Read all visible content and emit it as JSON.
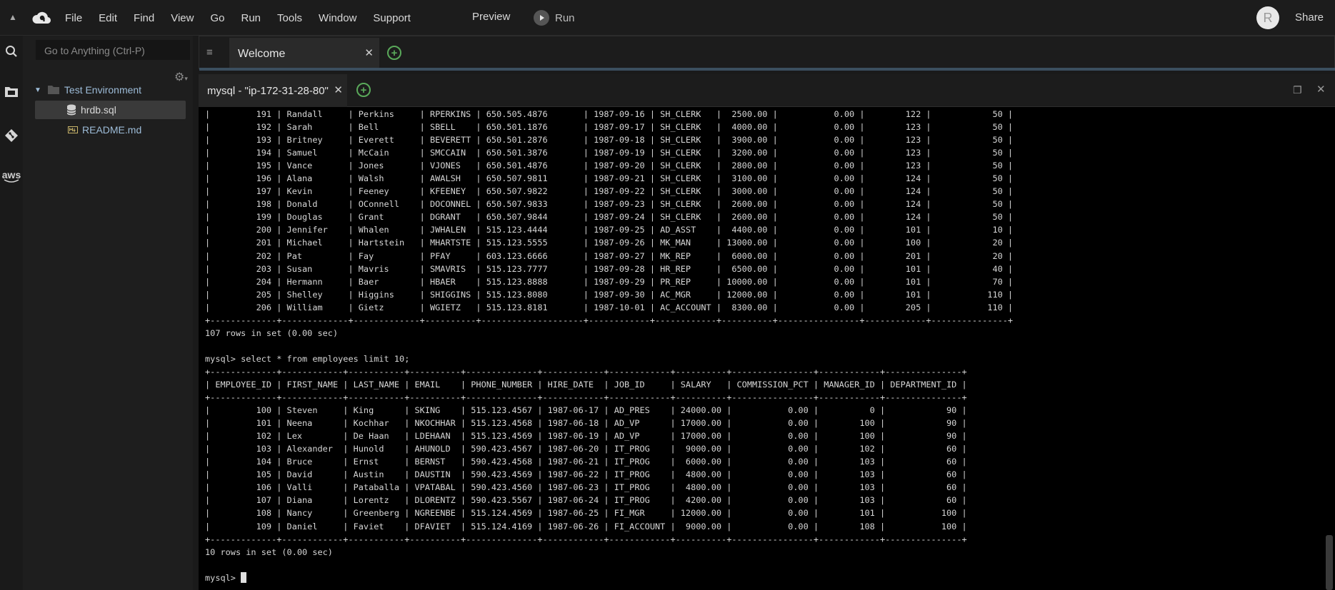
{
  "menubar": {
    "items": [
      "File",
      "Edit",
      "Find",
      "View",
      "Go",
      "Run",
      "Tools",
      "Window",
      "Support"
    ],
    "preview": "Preview",
    "run": "Run",
    "avatar_letter": "R",
    "share": "Share"
  },
  "tree": {
    "goto_placeholder": "Go to Anything (Ctrl-P)",
    "root": "Test Environment",
    "files": [
      "hrdb.sql",
      "README.md"
    ]
  },
  "tabs": {
    "welcome": "Welcome",
    "terminal_tab": "mysql - \"ip-172-31-28-80\""
  },
  "rail": {
    "aws": "aws"
  },
  "terminal": {
    "lines": [
      "|         191 | Randall     | Perkins     | RPERKINS | 650.505.4876       | 1987-09-16 | SH_CLERK   |  2500.00 |           0.00 |        122 |            50 |",
      "|         192 | Sarah       | Bell        | SBELL    | 650.501.1876       | 1987-09-17 | SH_CLERK   |  4000.00 |           0.00 |        123 |            50 |",
      "|         193 | Britney     | Everett     | BEVERETT | 650.501.2876       | 1987-09-18 | SH_CLERK   |  3900.00 |           0.00 |        123 |            50 |",
      "|         194 | Samuel      | McCain      | SMCCAIN  | 650.501.3876       | 1987-09-19 | SH_CLERK   |  3200.00 |           0.00 |        123 |            50 |",
      "|         195 | Vance       | Jones       | VJONES   | 650.501.4876       | 1987-09-20 | SH_CLERK   |  2800.00 |           0.00 |        123 |            50 |",
      "|         196 | Alana       | Walsh       | AWALSH   | 650.507.9811       | 1987-09-21 | SH_CLERK   |  3100.00 |           0.00 |        124 |            50 |",
      "|         197 | Kevin       | Feeney      | KFEENEY  | 650.507.9822       | 1987-09-22 | SH_CLERK   |  3000.00 |           0.00 |        124 |            50 |",
      "|         198 | Donald      | OConnell    | DOCONNEL | 650.507.9833       | 1987-09-23 | SH_CLERK   |  2600.00 |           0.00 |        124 |            50 |",
      "|         199 | Douglas     | Grant       | DGRANT   | 650.507.9844       | 1987-09-24 | SH_CLERK   |  2600.00 |           0.00 |        124 |            50 |",
      "|         200 | Jennifer    | Whalen      | JWHALEN  | 515.123.4444       | 1987-09-25 | AD_ASST    |  4400.00 |           0.00 |        101 |            10 |",
      "|         201 | Michael     | Hartstein   | MHARTSTE | 515.123.5555       | 1987-09-26 | MK_MAN     | 13000.00 |           0.00 |        100 |            20 |",
      "|         202 | Pat         | Fay         | PFAY     | 603.123.6666       | 1987-09-27 | MK_REP     |  6000.00 |           0.00 |        201 |            20 |",
      "|         203 | Susan       | Mavris      | SMAVRIS  | 515.123.7777       | 1987-09-28 | HR_REP     |  6500.00 |           0.00 |        101 |            40 |",
      "|         204 | Hermann     | Baer        | HBAER    | 515.123.8888       | 1987-09-29 | PR_REP     | 10000.00 |           0.00 |        101 |            70 |",
      "|         205 | Shelley     | Higgins     | SHIGGINS | 515.123.8080       | 1987-09-30 | AC_MGR     | 12000.00 |           0.00 |        101 |           110 |",
      "|         206 | William     | Gietz       | WGIETZ   | 515.123.8181       | 1987-10-01 | AC_ACCOUNT |  8300.00 |           0.00 |        205 |           110 |",
      "+-------------+-------------+-------------+----------+--------------------+------------+------------+----------+----------------+------------+---------------+",
      "107 rows in set (0.00 sec)",
      "",
      "mysql> select * from employees limit 10;",
      "+-------------+------------+-----------+----------+--------------+------------+------------+----------+----------------+------------+---------------+",
      "| EMPLOYEE_ID | FIRST_NAME | LAST_NAME | EMAIL    | PHONE_NUMBER | HIRE_DATE  | JOB_ID     | SALARY   | COMMISSION_PCT | MANAGER_ID | DEPARTMENT_ID |",
      "+-------------+------------+-----------+----------+--------------+------------+------------+----------+----------------+------------+---------------+",
      "|         100 | Steven     | King      | SKING    | 515.123.4567 | 1987-06-17 | AD_PRES    | 24000.00 |           0.00 |          0 |            90 |",
      "|         101 | Neena      | Kochhar   | NKOCHHAR | 515.123.4568 | 1987-06-18 | AD_VP      | 17000.00 |           0.00 |        100 |            90 |",
      "|         102 | Lex        | De Haan   | LDEHAAN  | 515.123.4569 | 1987-06-19 | AD_VP      | 17000.00 |           0.00 |        100 |            90 |",
      "|         103 | Alexander  | Hunold    | AHUNOLD  | 590.423.4567 | 1987-06-20 | IT_PROG    |  9000.00 |           0.00 |        102 |            60 |",
      "|         104 | Bruce      | Ernst     | BERNST   | 590.423.4568 | 1987-06-21 | IT_PROG    |  6000.00 |           0.00 |        103 |            60 |",
      "|         105 | David      | Austin    | DAUSTIN  | 590.423.4569 | 1987-06-22 | IT_PROG    |  4800.00 |           0.00 |        103 |            60 |",
      "|         106 | Valli      | Pataballa | VPATABAL | 590.423.4560 | 1987-06-23 | IT_PROG    |  4800.00 |           0.00 |        103 |            60 |",
      "|         107 | Diana      | Lorentz   | DLORENTZ | 590.423.5567 | 1987-06-24 | IT_PROG    |  4200.00 |           0.00 |        103 |            60 |",
      "|         108 | Nancy      | Greenberg | NGREENBE | 515.124.4569 | 1987-06-25 | FI_MGR     | 12000.00 |           0.00 |        101 |           100 |",
      "|         109 | Daniel     | Faviet    | DFAVIET  | 515.124.4169 | 1987-06-26 | FI_ACCOUNT |  9000.00 |           0.00 |        108 |           100 |",
      "+-------------+------------+-----------+----------+--------------+------------+------------+----------+----------------+------------+---------------+",
      "10 rows in set (0.00 sec)",
      ""
    ],
    "prompt": "mysql> "
  }
}
